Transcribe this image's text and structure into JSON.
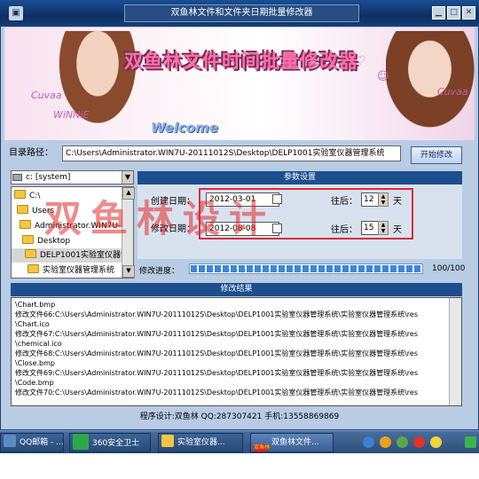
{
  "window": {
    "title": "双鱼林文件和文件夹日期批量修改器"
  },
  "banner": {
    "title": "双鱼林文件时间批量修改器",
    "welcome": "Welcome",
    "deco_left": "Cuvaa",
    "deco_left2": "WiNNiE",
    "deco_right": "Cuvaa"
  },
  "path": {
    "label": "目录路径：",
    "value": "C:\\Users\\Administrator.WIN7U-20111012S\\Desktop\\DELP1001实验室仪器管理系统",
    "button": "开始修改"
  },
  "drive": {
    "value": "c: [system]"
  },
  "tree": [
    "C:\\",
    "Users",
    "Administrator.WIN7U-2011",
    "Desktop",
    "DELP1001实验室仪器管",
    "实验室仪器管理系统"
  ],
  "params": {
    "header": "参数设置",
    "create_label": "创建日期：",
    "create_date": "2012-03-01",
    "create_after_label": "往后：",
    "create_days": "12",
    "modify_label": "修改日期：",
    "modify_date": "2012-08-08",
    "modify_after_label": "往后：",
    "modify_days": "15",
    "unit": "天"
  },
  "progress": {
    "label": "修改进度：",
    "value_text": "100/100",
    "fraction": 1.0
  },
  "results": {
    "header": "修改结果",
    "lines": [
      "\\Chart.bmp",
      "修改文件66:C:\\Users\\Administrator.WIN7U-20111012S\\Desktop\\DELP1001实验室仪器管理系统\\实验室仪器管理系统\\res",
      "\\Chart.ico",
      "修改文件67:C:\\Users\\Administrator.WIN7U-20111012S\\Desktop\\DELP1001实验室仪器管理系统\\实验室仪器管理系统\\res",
      "\\chemical.ico",
      "修改文件68:C:\\Users\\Administrator.WIN7U-20111012S\\Desktop\\DELP1001实验室仪器管理系统\\实验室仪器管理系统\\res",
      "\\Close.bmp",
      "修改文件69:C:\\Users\\Administrator.WIN7U-20111012S\\Desktop\\DELP1001实验室仪器管理系统\\实验室仪器管理系统\\res",
      "\\Code.bmp",
      "修改文件70:C:\\Users\\Administrator.WIN7U-20111012S\\Desktop\\DELP1001实验室仪器管理系统\\实验室仪器管理系统\\res"
    ]
  },
  "footer": "程序设计:双鱼林  QQ:287307421 手机:13558869869",
  "watermark": "双鱼林设计",
  "taskbar": {
    "items": [
      "QQ邮箱 - ...",
      "360安全卫士",
      "实验室仪器...",
      "双鱼林文件..."
    ],
    "badge": "双鱼林",
    "colors": {
      "green": "#2fa84a",
      "folder": "#f5c542",
      "red": "#d8232a"
    }
  }
}
